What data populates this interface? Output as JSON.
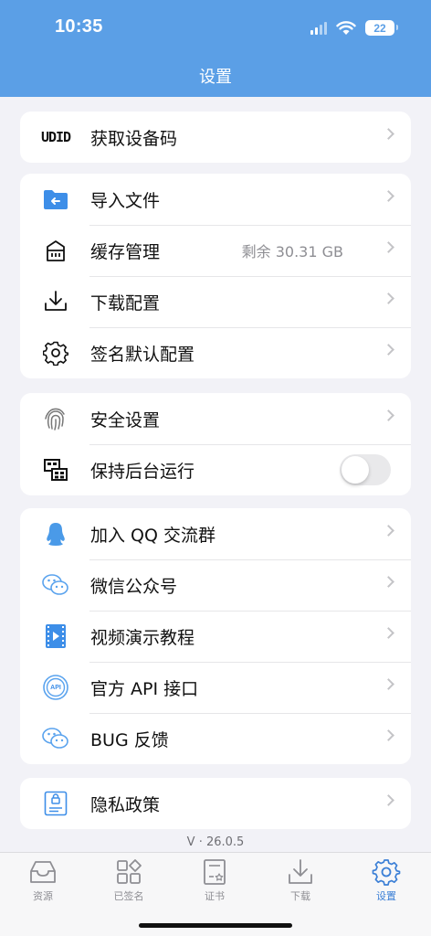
{
  "status": {
    "time": "10:35",
    "battery": "22"
  },
  "nav": {
    "title": "设置"
  },
  "groups": [
    {
      "items": [
        {
          "label": "获取设备码",
          "icon": "udid-icon",
          "icon_text": "UDID"
        }
      ]
    },
    {
      "items": [
        {
          "label": "导入文件",
          "icon": "folder-import-icon"
        },
        {
          "label": "缓存管理",
          "icon": "storage-icon",
          "value": "剩余 30.31 GB"
        },
        {
          "label": "下载配置",
          "icon": "download-icon"
        },
        {
          "label": "签名默认配置",
          "icon": "gear-icon"
        }
      ]
    },
    {
      "items": [
        {
          "label": "安全设置",
          "icon": "fingerprint-icon"
        },
        {
          "label": "保持后台运行",
          "icon": "background-run-icon",
          "toggle": false
        }
      ]
    },
    {
      "items": [
        {
          "label": "加入 QQ 交流群",
          "icon": "qq-icon"
        },
        {
          "label": "微信公众号",
          "icon": "wechat-icon"
        },
        {
          "label": "视频演示教程",
          "icon": "video-icon"
        },
        {
          "label": "官方 API 接口",
          "icon": "api-icon",
          "icon_text": "API"
        },
        {
          "label": "BUG 反馈",
          "icon": "feedback-icon"
        }
      ]
    },
    {
      "items": [
        {
          "label": "隐私政策",
          "icon": "privacy-icon"
        }
      ]
    }
  ],
  "version": "V · 26.0.5",
  "tabs": [
    {
      "label": "资源",
      "icon": "inbox-icon"
    },
    {
      "label": "已签名",
      "icon": "apps-grid-icon"
    },
    {
      "label": "证书",
      "icon": "certificate-icon"
    },
    {
      "label": "下载",
      "icon": "download-tab-icon"
    },
    {
      "label": "设置",
      "icon": "settings-tab-icon",
      "active": true
    }
  ],
  "colors": {
    "header": "#5b9fe6",
    "accent": "#3b7fd6",
    "background": "#f2f2f7"
  }
}
